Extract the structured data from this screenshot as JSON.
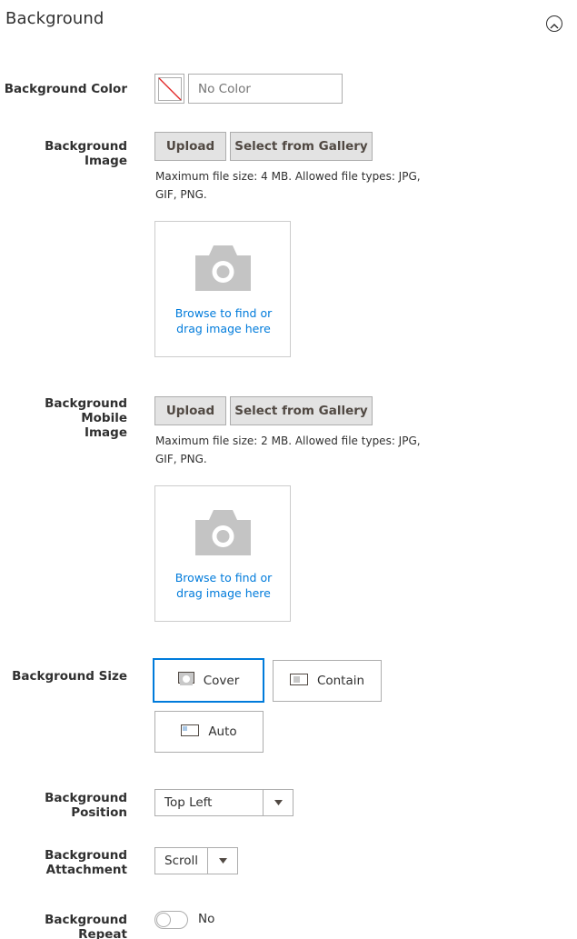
{
  "section": {
    "title": "Background"
  },
  "color": {
    "label": "Background Color",
    "value": "",
    "placeholder": "No Color"
  },
  "bg_image": {
    "label": "Background Image",
    "upload_label": "Upload",
    "gallery_label": "Select from Gallery",
    "note_line1": "Maximum file size: 4 MB. Allowed file types: JPG,",
    "note_line2": "GIF, PNG.",
    "browse_line1": "Browse to find or",
    "browse_line2": "drag image here"
  },
  "bg_mobile": {
    "label_line1": "Background Mobile",
    "label_line2": "Image",
    "upload_label": "Upload",
    "gallery_label": "Select from Gallery",
    "note_line1": "Maximum file size: 2 MB. Allowed file types: JPG,",
    "note_line2": "GIF, PNG.",
    "browse_line1": "Browse to find or",
    "browse_line2": "drag image here"
  },
  "size": {
    "label": "Background Size",
    "options": [
      "Cover",
      "Contain",
      "Auto"
    ],
    "selected": "Cover"
  },
  "position": {
    "label_line1": "Background",
    "label_line2": "Position",
    "value": "Top Left"
  },
  "attachment": {
    "label_line1": "Background",
    "label_line2": "Attachment",
    "value": "Scroll"
  },
  "repeat": {
    "label": "Background Repeat",
    "state_label": "No"
  },
  "colors": {
    "accent": "#007bdb",
    "button_bg": "#e3e3e3",
    "border": "#adadad",
    "icon_gray": "#c4c4c4"
  }
}
